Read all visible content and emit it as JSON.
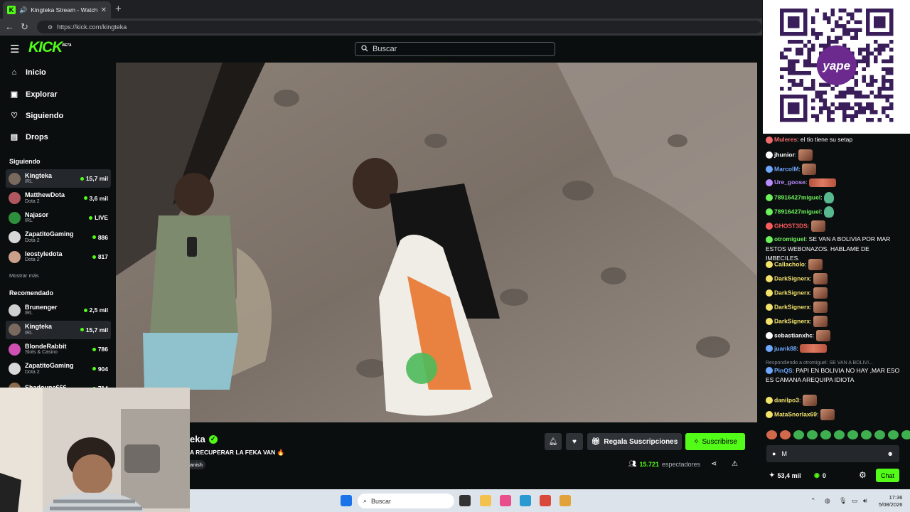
{
  "browser": {
    "tab_title": "Kingteka Stream - Watch Live",
    "tab_favicon": "K",
    "url": "https://kick.com/kingteka"
  },
  "header": {
    "logo": "KICK",
    "logo_badge": "BETA",
    "search_placeholder": "Buscar"
  },
  "sidebar": {
    "nav": [
      {
        "label": "Inicio",
        "icon": "home-icon"
      },
      {
        "label": "Explorar",
        "icon": "browse-icon"
      },
      {
        "label": "Siguiendo",
        "icon": "heart-icon"
      },
      {
        "label": "Drops",
        "icon": "drops-icon"
      }
    ],
    "following_title": "Siguiendo",
    "following": [
      {
        "name": "Kingteka",
        "category": "IRL",
        "viewers": "15,7 mil",
        "color": "#7a6a5e"
      },
      {
        "name": "MatthewDota",
        "category": "Dota 2",
        "viewers": "3,6 mil",
        "color": "#b0585f"
      },
      {
        "name": "Najasor",
        "category": "IRL",
        "viewers": "LIVE",
        "color": "#2e8f3c"
      },
      {
        "name": "ZapatitoGaming",
        "category": "Dota 2",
        "viewers": "886",
        "color": "#d8d8d8"
      },
      {
        "name": "leostyledota",
        "category": "Dota 2",
        "viewers": "817",
        "color": "#caa08a"
      }
    ],
    "more_label": "Mostrar más",
    "recommended_title": "Recomendado",
    "recommended": [
      {
        "name": "Brunenger",
        "category": "IRL",
        "viewers": "2,5 mil",
        "color": "#cfcfcf"
      },
      {
        "name": "Kingteka",
        "category": "IRL",
        "viewers": "15,7 mil",
        "color": "#7a6a5e"
      },
      {
        "name": "BlondeRabbit",
        "category": "Slots & Casino",
        "viewers": "786",
        "color": "#d04fb3"
      },
      {
        "name": "ZapatitoGaming",
        "category": "Dota 2",
        "viewers": "904",
        "color": "#d8d8d8"
      },
      {
        "name": "Shadoune666",
        "category": "",
        "viewers": "714",
        "color": "#8a6b4f"
      }
    ]
  },
  "stream": {
    "name_partial": "eka",
    "title_partial": "A RECUPERAR LA FEKA VAN 🔥",
    "tag_partial": "anish",
    "gift_label": "Regala Suscripciones",
    "subscribe_label": "Suscribirse",
    "viewer_count": "15.721",
    "viewer_label": "espectadores"
  },
  "chat": {
    "messages": [
      {
        "user": "Muleres",
        "text": "el tio tiene su setap",
        "color": "#f26b6b"
      },
      {
        "user": "jhunior",
        "text": "",
        "color": "#ffffff",
        "emote": "face"
      },
      {
        "user": "MarcolM",
        "text": "",
        "color": "#6ea8ff",
        "emote": "face"
      },
      {
        "user": "Ure_goose",
        "text": "",
        "color": "#b98cff",
        "emote": "wide"
      },
      {
        "user": "78916427miguel",
        "text": "",
        "color": "#6cf25a",
        "emote": "frog"
      },
      {
        "user": "78916427miguel",
        "text": "",
        "color": "#6cf25a",
        "emote": "frog"
      },
      {
        "user": "GHOST3DS",
        "text": "",
        "color": "#ff5c5c",
        "emote": "face"
      },
      {
        "user": "otromiguel",
        "text": "SE VAN A BOLIVIA POR MAR ESTOS WEBONAZOS. HABLAME DE IMBECILES.",
        "color": "#6cf25a"
      },
      {
        "user": "Callacholo",
        "text": "",
        "color": "#f3e36b",
        "emote": "face"
      },
      {
        "user": "DarkSignerx",
        "text": "",
        "color": "#f3e36b",
        "emote": "face"
      },
      {
        "user": "DarkSignerx",
        "text": "",
        "color": "#f3e36b",
        "emote": "face"
      },
      {
        "user": "DarkSignerx",
        "text": "",
        "color": "#f3e36b",
        "emote": "face"
      },
      {
        "user": "DarkSignerx",
        "text": "",
        "color": "#f3e36b",
        "emote": "face"
      },
      {
        "user": "sebastianxhc",
        "text": "",
        "color": "#ffffff",
        "emote": "face"
      },
      {
        "user": "juank88",
        "text": "",
        "color": "#6ea8ff",
        "emote": "wide"
      }
    ],
    "reply_context": "Respondiendo a otromiguel: SE VAN A BOLIVI...",
    "reply_msg": {
      "user": "PinQS",
      "text": "PAPI EN BOLIVIA NO HAY ,MAR ESO ES CAMANA AREQUIPA IDIOTA",
      "color": "#6ea8ff"
    },
    "after": [
      {
        "user": "danilpo3",
        "text": "",
        "color": "#f3e36b",
        "emote": "face"
      },
      {
        "user": "MataSnorlax69",
        "text": "",
        "color": "#f3e36b",
        "emote": "face"
      }
    ],
    "input_value": "M",
    "points": "53,4 mil",
    "kick_points": "0",
    "chat_button": "Chat"
  },
  "qr": {
    "brand": "yape"
  },
  "taskbar": {
    "search_placeholder": "Buscar",
    "time": "17:36",
    "date": "5/08/2026"
  }
}
